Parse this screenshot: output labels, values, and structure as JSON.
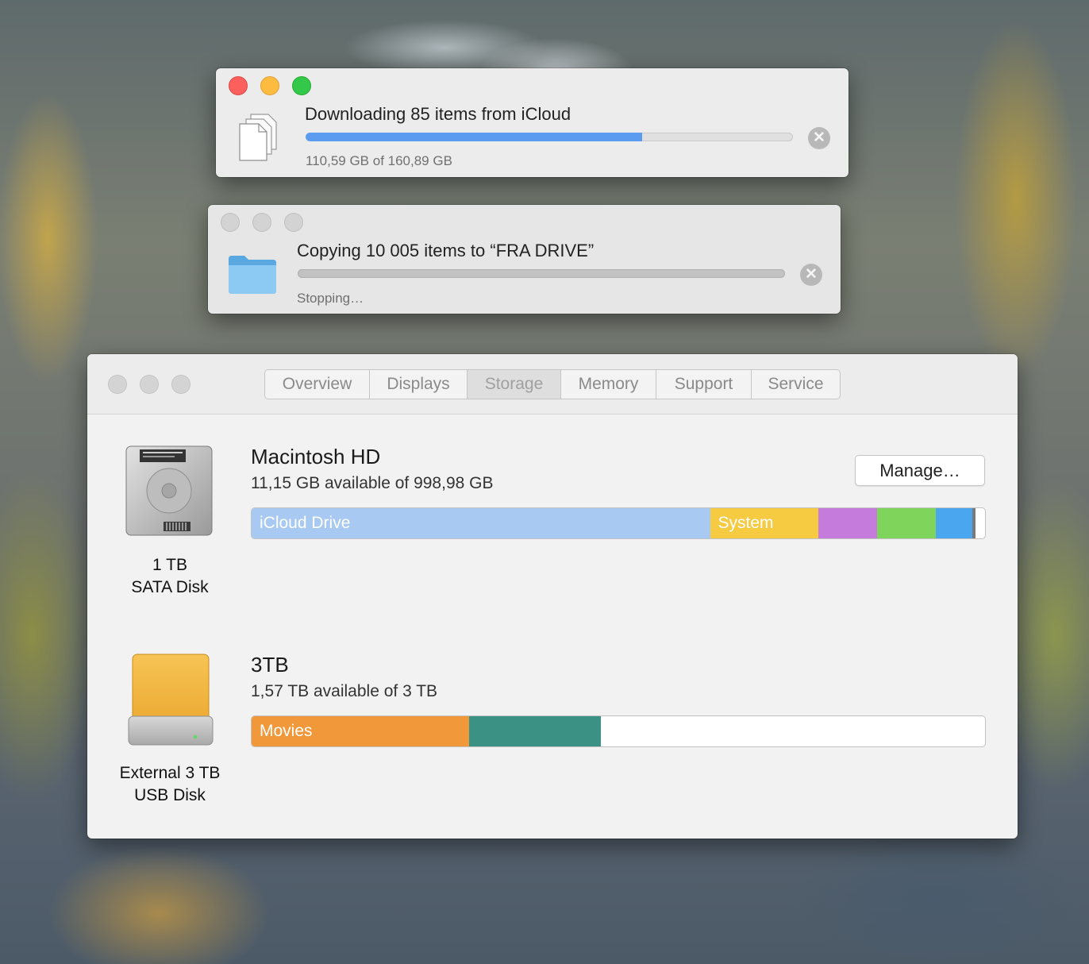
{
  "download": {
    "title": "Downloading 85 items from iCloud",
    "status": "110,59 GB of 160,89 GB",
    "progress": 0.69,
    "icon": "documents-icon"
  },
  "copy": {
    "title": "Copying 10 005 items to “FRA DRIVE”",
    "status": "Stopping…",
    "icon": "folder-icon"
  },
  "about": {
    "tabs": [
      "Overview",
      "Displays",
      "Storage",
      "Memory",
      "Support",
      "Service"
    ],
    "active_tab": "Storage",
    "manage_label": "Manage…",
    "disks": [
      {
        "name": "Macintosh HD",
        "available": "11,15 GB available of 998,98 GB",
        "caption_line1": "1 TB",
        "caption_line2": "SATA Disk",
        "icon": "internal-hard-drive-icon",
        "segments": [
          {
            "label": "iCloud Drive",
            "share": 0.625,
            "color": "#a8c9f2"
          },
          {
            "label": "System",
            "share": 0.148,
            "color": "#f6ca41"
          },
          {
            "label": "",
            "share": 0.08,
            "color": "#c47bdb"
          },
          {
            "label": "",
            "share": 0.08,
            "color": "#7fd55b"
          },
          {
            "label": "",
            "share": 0.05,
            "color": "#4aa6ee"
          },
          {
            "label": "",
            "share": 0.004,
            "color": "#7a7a7a"
          }
        ]
      },
      {
        "name": "3TB",
        "available": "1,57 TB available of 3 TB",
        "caption_line1": "External 3 TB",
        "caption_line2": "USB Disk",
        "icon": "external-usb-drive-icon",
        "segments": [
          {
            "label": "Movies",
            "share": 0.297,
            "color": "#f0983a"
          },
          {
            "label": "",
            "share": 0.179,
            "color": "#3b9184"
          }
        ]
      }
    ]
  },
  "colors": {
    "progress_blue": "#5b9cf0",
    "close_red": "#fc605c",
    "minimize_yellow": "#fdbc40",
    "zoom_green": "#34c84a"
  }
}
